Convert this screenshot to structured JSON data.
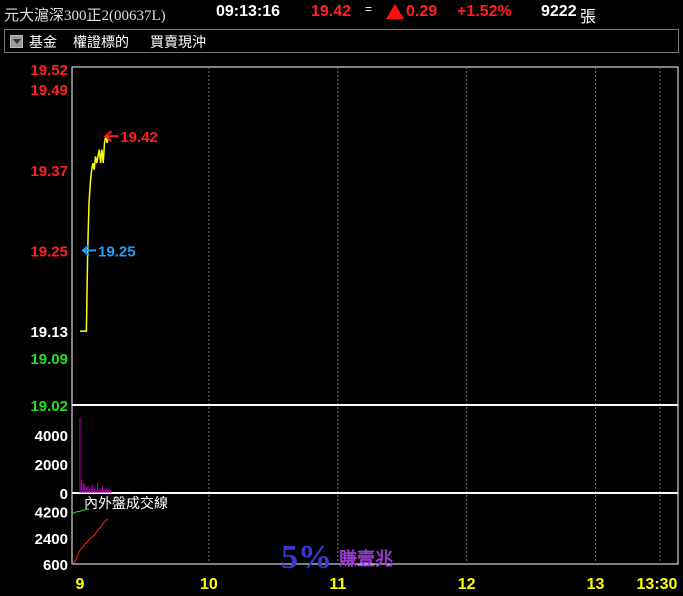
{
  "header": {
    "name": "元大滬深300正2(00637L)",
    "time": "09:13:16",
    "price": "19.42",
    "eq": "=",
    "change": "0.29",
    "percent": "+1.52%",
    "volume": "9222",
    "unit": "張"
  },
  "menu": {
    "items": [
      "基金",
      "權證標的",
      "買賣現沖"
    ]
  },
  "colors": {
    "up": "#ff2020",
    "down": "#20e020",
    "price_line": "#ffff00",
    "volume_bar": "#c000c0",
    "low_marker": "#1ea0ff",
    "inout_line": "#ff2020",
    "grid": "#ffffff"
  },
  "chart_data": [
    {
      "type": "line",
      "name": "price",
      "ylim": [
        19.02,
        19.52
      ],
      "y_ticks": [
        {
          "label": "19.52",
          "value": 19.52,
          "color": "up"
        },
        {
          "label": "19.49",
          "value": 19.49,
          "color": "up"
        },
        {
          "label": "19.37",
          "value": 19.37,
          "color": "up"
        },
        {
          "label": "19.25",
          "value": 19.25,
          "color": "up"
        },
        {
          "label": "19.13",
          "value": 19.13,
          "color": "flat"
        },
        {
          "label": "19.09",
          "value": 19.09,
          "color": "down"
        },
        {
          "label": "19.02",
          "value": 19.02,
          "color": "down"
        }
      ],
      "reference": 19.13,
      "x_ticks": [
        "9",
        "10",
        "11",
        "12",
        "13",
        "13:30"
      ],
      "series": [
        {
          "x": [
            9.0,
            9.003,
            9.01,
            9.02,
            9.03,
            9.04,
            9.05,
            9.06,
            9.07,
            9.08,
            9.09,
            9.1,
            9.11,
            9.12,
            9.13,
            9.14,
            9.15,
            9.16,
            9.17,
            9.18,
            9.19,
            9.2,
            9.21,
            9.22
          ],
          "y": [
            19.13,
            19.13,
            19.13,
            19.13,
            19.13,
            19.13,
            19.13,
            19.25,
            19.32,
            19.35,
            19.37,
            19.38,
            19.37,
            19.39,
            19.38,
            19.39,
            19.4,
            19.38,
            19.4,
            19.38,
            19.41,
            19.42,
            19.41,
            19.42
          ]
        }
      ],
      "markers": [
        {
          "label": "19.42",
          "value": 19.42,
          "color": "up"
        },
        {
          "label": "19.25",
          "value": 19.25,
          "color": "low"
        }
      ]
    },
    {
      "type": "bar",
      "name": "volume",
      "ylim": [
        0,
        6000
      ],
      "y_ticks": [
        "4000",
        "2000",
        "0"
      ],
      "values": [
        5200,
        900,
        700,
        600,
        400,
        500,
        300,
        400,
        600,
        300,
        200,
        700,
        300,
        200,
        500,
        300,
        200,
        400,
        300,
        200
      ]
    },
    {
      "type": "line",
      "name": "inout",
      "title": "內外盤成交線",
      "ylim": [
        600,
        5400
      ],
      "y_ticks": [
        "4200",
        "2400",
        "600"
      ],
      "series": [
        {
          "name": "outer",
          "values": [
            600,
            700,
            900,
            1200,
            1500,
            1700,
            1800,
            2000,
            2100,
            2300,
            2400,
            2500,
            2600,
            2800,
            3000,
            3100,
            3300,
            3500,
            3600,
            3700
          ]
        },
        {
          "name": "inner",
          "values": [
            4100,
            4100,
            4150,
            4200,
            4200,
            4250,
            4300,
            4300,
            4350,
            4350
          ]
        }
      ]
    }
  ],
  "watermark": {
    "big": "5%",
    "small": "賺壹兆"
  }
}
